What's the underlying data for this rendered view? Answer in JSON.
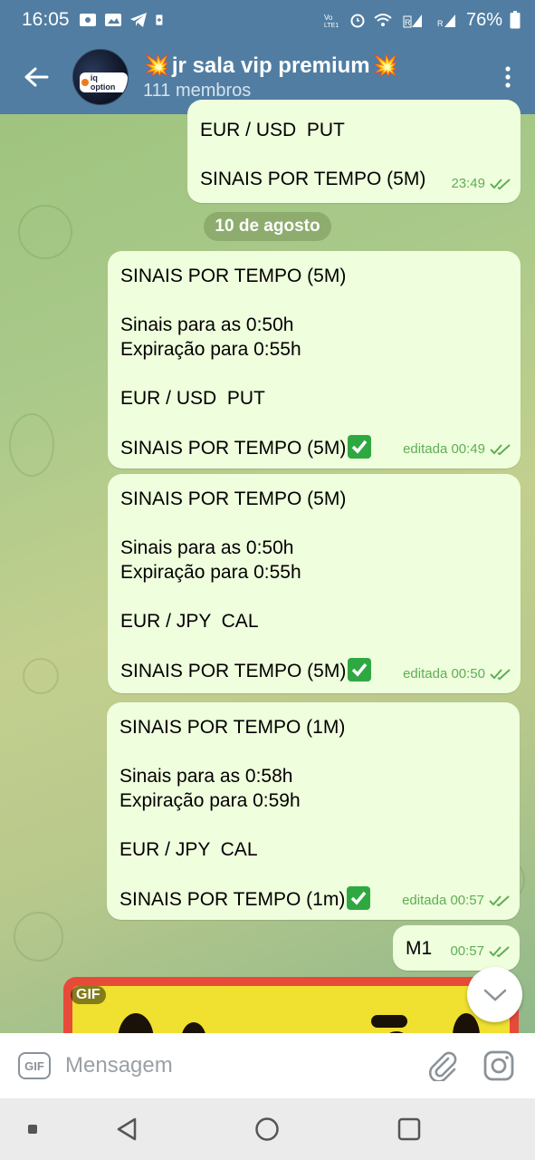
{
  "status_bar": {
    "time": "16:05",
    "battery": "76%",
    "left_icons": [
      "notification-icon",
      "photo-icon",
      "telegram-icon",
      "sim-icon"
    ],
    "right_icons": [
      "volte-icon",
      "alarm-icon",
      "wifi-icon",
      "signal-icon",
      "signal-icon",
      "battery-icon"
    ]
  },
  "header": {
    "title": "jr sala vip premium",
    "subtitle": "111 membros",
    "avatar_text": "iq option",
    "title_emoji": "💥"
  },
  "messages": [
    {
      "lines": [
        "EUR / USD  PUT",
        "",
        "SINAIS POR TEMPO (5M)"
      ],
      "time": "23:49",
      "edited": ""
    },
    {
      "lines": [
        "SINAIS POR TEMPO (5M)",
        "",
        "Sinais para as 0:50h",
        "Expiração para 0:55h",
        "",
        "EUR / USD  PUT",
        "",
        "SINAIS POR TEMPO (5M)"
      ],
      "time": "editada 00:49",
      "emoji_last": true
    },
    {
      "lines": [
        "SINAIS POR TEMPO (5M)",
        "",
        "Sinais para as 0:50h",
        "Expiração para 0:55h",
        "",
        "EUR / JPY  CAL",
        "",
        "SINAIS POR TEMPO (5M)"
      ],
      "time": "editada 00:50",
      "emoji_last": true
    },
    {
      "lines": [
        "SINAIS POR TEMPO (1M)",
        "",
        "Sinais para as 0:58h",
        "Expiração para 0:59h",
        "",
        "EUR / JPY  CAL",
        "",
        "SINAIS POR TEMPO (1m)"
      ],
      "time": "editada 00:57",
      "emoji_last": true
    },
    {
      "lines": [
        "M1"
      ],
      "time": "00:57"
    }
  ],
  "date_separator": "10 de agosto",
  "gif_label": "GIF",
  "composer": {
    "gif_button": "GIF",
    "placeholder": "Mensagem"
  },
  "colors": {
    "header": "#517da2",
    "bubble": "#effedd",
    "time": "#5fae56"
  }
}
